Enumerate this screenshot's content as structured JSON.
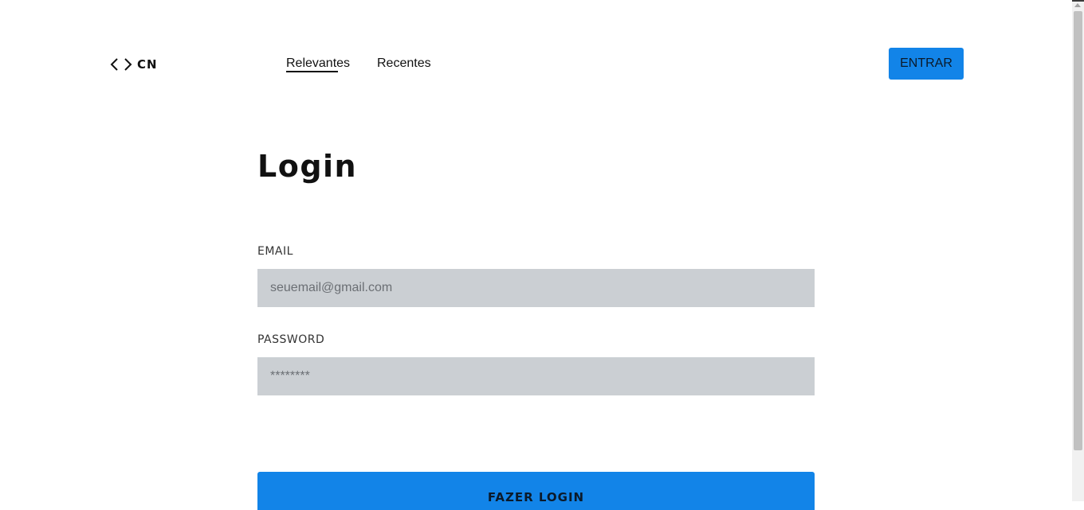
{
  "header": {
    "logo_text": "CN",
    "nav": [
      {
        "label": "Relevantes",
        "active": true
      },
      {
        "label": "Recentes",
        "active": false
      }
    ],
    "entrar_label": "ENTRAR"
  },
  "form": {
    "title": "Login",
    "email_label": "EMAIL",
    "email_placeholder": "seuemail@gmail.com",
    "password_label": "PASSWORD",
    "password_placeholder": "********",
    "submit_label": "FAZER LOGIN"
  },
  "colors": {
    "accent": "#1284e8",
    "input_bg": "#cbcfd3"
  },
  "icons": {
    "logo": "code-brackets-icon"
  }
}
